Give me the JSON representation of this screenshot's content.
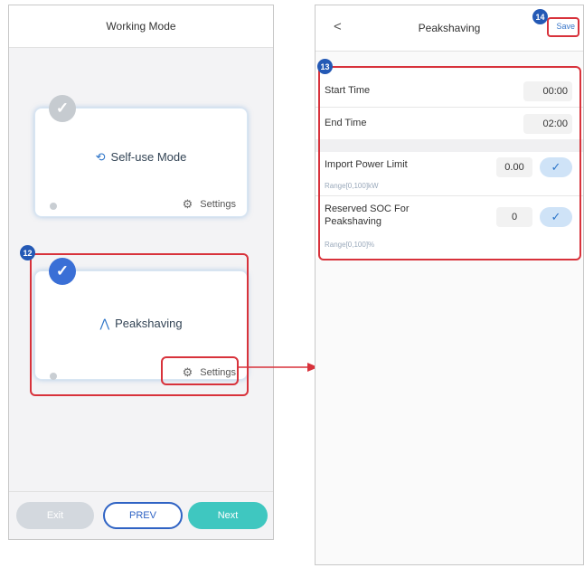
{
  "left_screen": {
    "title": "Working Mode",
    "modes": [
      {
        "label": "Self-use Mode",
        "icon": "sync-icon",
        "settings_label": "Settings",
        "selected": false
      },
      {
        "label": "Peakshaving",
        "icon": "peak-chart-icon",
        "settings_label": "Settings",
        "selected": true
      }
    ],
    "footer": {
      "exit": "Exit",
      "prev": "PREV",
      "next": "Next"
    }
  },
  "right_screen": {
    "back": "<",
    "title": "Peakshaving",
    "save": "Save",
    "start_time_label": "Start Time",
    "start_time_value": "00:00",
    "end_time_label": "End Time",
    "end_time_value": "02:00",
    "import_limit_label": "Import Power Limit",
    "import_limit_value": "0.00",
    "import_limit_range": "Range[0,100]kW",
    "soc_label_line1": "Reserved SOC For",
    "soc_label_line2": "Peakshaving",
    "soc_value": "0",
    "soc_range": "Range[0,100]%",
    "confirm_glyph": "✓"
  },
  "markers": {
    "m12": "12",
    "m13": "13",
    "m14": "14"
  },
  "colors": {
    "accent": "#2459b5",
    "highlight": "#d8323b",
    "next_button": "#3fc7c0"
  }
}
